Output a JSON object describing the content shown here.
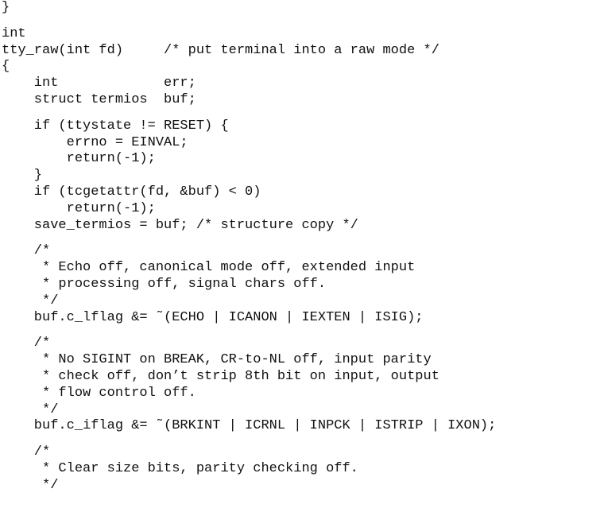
{
  "code": {
    "blocks": [
      [
        "}"
      ],
      [
        "int",
        "tty_raw(int fd)     /* put terminal into a raw mode */",
        "{",
        "    int             err;",
        "    struct termios  buf;"
      ],
      [
        "    if (ttystate != RESET) {",
        "        errno = EINVAL;",
        "        return(-1);",
        "    }",
        "    if (tcgetattr(fd, &buf) < 0)",
        "        return(-1);",
        "    save_termios = buf; /* structure copy */"
      ],
      [
        "    /*",
        "     * Echo off, canonical mode off, extended input",
        "     * processing off, signal chars off.",
        "     */",
        "    buf.c_lflag &= ˜(ECHO | ICANON | IEXTEN | ISIG);"
      ],
      [
        "    /*",
        "     * No SIGINT on BREAK, CR-to-NL off, input parity",
        "     * check off, don’t strip 8th bit on input, output",
        "     * flow control off.",
        "     */",
        "    buf.c_iflag &= ˜(BRKINT | ICRNL | INPCK | ISTRIP | IXON);"
      ],
      [
        "    /*",
        "     * Clear size bits, parity checking off.",
        "     */"
      ]
    ]
  }
}
